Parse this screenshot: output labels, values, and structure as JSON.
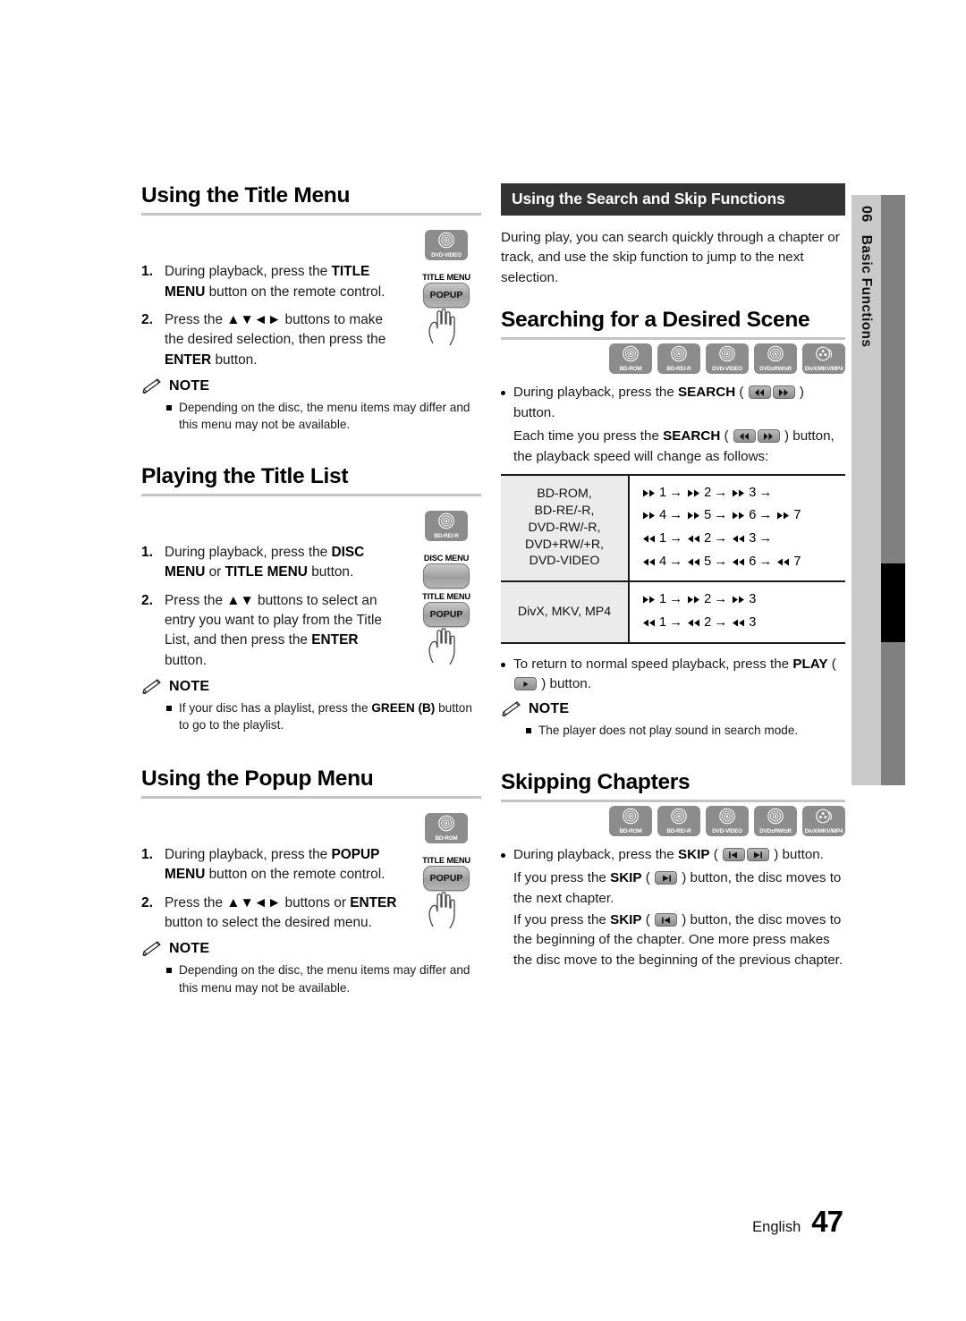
{
  "sidebar": {
    "chapter_number": "06",
    "chapter_title": "Basic Functions"
  },
  "footer": {
    "language": "English",
    "page_number": "47"
  },
  "left_column": {
    "sections": [
      {
        "heading": "Using the Title Menu",
        "disc_badges": [
          "DVD-VIDEO"
        ],
        "remote": {
          "labels": [
            "TITLE MENU"
          ],
          "buttons": [
            "POPUP"
          ]
        },
        "steps": [
          {
            "num": "1.",
            "text": "During playback, press the TITLE MENU button on the remote control."
          },
          {
            "num": "2.",
            "text": "Press the ▲▼◄► buttons to make the desired selection, then press the ENTER button."
          }
        ],
        "note_label": "NOTE",
        "notes": [
          "Depending on the disc, the menu items may differ and this menu may not be available."
        ]
      },
      {
        "heading": "Playing the Title List",
        "disc_badges": [
          "BD-RE/-R"
        ],
        "remote": {
          "labels": [
            "DISC MENU",
            "TITLE MENU"
          ],
          "buttons": [
            "",
            "POPUP"
          ]
        },
        "steps": [
          {
            "num": "1.",
            "text": "During playback, press the DISC MENU or TITLE MENU button."
          },
          {
            "num": "2.",
            "text": "Press the ▲▼ buttons to select an entry you want to play from the Title List, and then press the ENTER button."
          }
        ],
        "note_label": "NOTE",
        "notes": [
          "If your disc has a playlist, press the GREEN (B) button to go to the playlist."
        ]
      },
      {
        "heading": "Using the Popup Menu",
        "disc_badges": [
          "BD-ROM"
        ],
        "remote": {
          "labels": [
            "TITLE MENU"
          ],
          "buttons": [
            "POPUP"
          ]
        },
        "steps": [
          {
            "num": "1.",
            "text": "During playback, press the POPUP MENU button on the remote control."
          },
          {
            "num": "2.",
            "text": "Press the ▲▼◄► buttons or ENTER button to select the desired menu."
          }
        ],
        "note_label": "NOTE",
        "notes": [
          "Depending on the disc, the menu items may differ and this menu may not be available."
        ]
      }
    ]
  },
  "right_column": {
    "banner_title": "Using the Search and Skip Functions",
    "intro": "During play, you can search quickly through a chapter or track, and use the skip function to jump to the next selection.",
    "search_section": {
      "heading": "Searching for a Desired Scene",
      "disc_badges": [
        "BD-ROM",
        "BD-RE/-R",
        "DVD-VIDEO",
        "DVD±RW/±R",
        "DivX/MKV/MP4"
      ],
      "bullet1_a": "During playback, press the SEARCH (",
      "bullet1_b": ") button.",
      "bullet1_label": "SEARCH",
      "para2_a": "Each time you press the SEARCH (",
      "para2_b": ") button, the playback speed will change as follows:",
      "bullet2_a": "To return to normal speed playback, press the PLAY (",
      "bullet2_b": ") button.",
      "note_label": "NOTE",
      "notes": [
        "The player does not play sound in search mode."
      ]
    },
    "skip_section": {
      "heading": "Skipping Chapters",
      "disc_badges": [
        "BD-ROM",
        "BD-RE/-R",
        "DVD-VIDEO",
        "DVD±RW/±R",
        "DivX/MKV/MP4"
      ],
      "bullet1_a": "During playback, press the SKIP (",
      "bullet1_b": ") button.",
      "para2_a": "If you press the SKIP (",
      "para2_b": ") button, the disc moves to the next chapter.",
      "para3_a": "If you press the SKIP (",
      "para3_b": ") button, the disc moves to the beginning of the chapter. One more press makes the disc move to the beginning of the previous chapter."
    }
  },
  "speed_table": {
    "rows": [
      {
        "disc_types": "BD-ROM,\nBD-RE/-R,\nDVD-RW/-R,\nDVD+RW/+R,\nDVD-VIDEO",
        "lines": [
          {
            "dir": "ff",
            "steps": [
              "1",
              "2",
              "3"
            ],
            "trailing_arrow": true
          },
          {
            "dir": "ff",
            "steps": [
              "4",
              "5",
              "6",
              "7"
            ],
            "trailing_arrow": false
          },
          {
            "dir": "rw",
            "steps": [
              "1",
              "2",
              "3"
            ],
            "trailing_arrow": true
          },
          {
            "dir": "rw",
            "steps": [
              "4",
              "5",
              "6",
              "7"
            ],
            "trailing_arrow": false
          }
        ]
      },
      {
        "disc_types": "DivX, MKV, MP4",
        "lines": [
          {
            "dir": "ff",
            "steps": [
              "1",
              "2",
              "3"
            ],
            "trailing_arrow": false
          },
          {
            "dir": "rw",
            "steps": [
              "1",
              "2",
              "3"
            ],
            "trailing_arrow": false
          }
        ]
      }
    ]
  }
}
